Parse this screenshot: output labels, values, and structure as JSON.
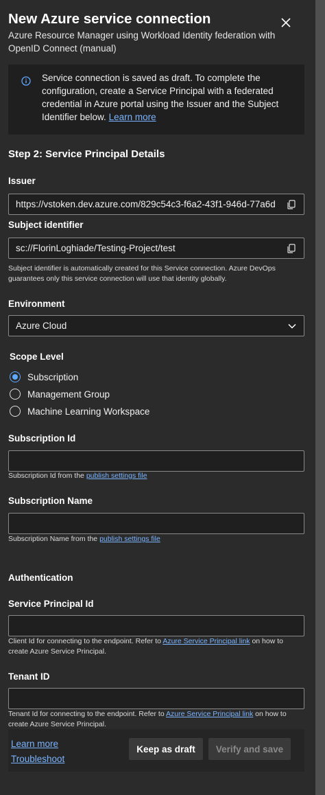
{
  "header": {
    "title": "New Azure service connection",
    "subtitle": "Azure Resource Manager using Workload Identity federation with OpenID Connect (manual)"
  },
  "info": {
    "text": "Service connection is saved as draft. To complete the configuration, create a Service Principal with a federated credential in Azure portal using the Issuer and the Subject Identifier below.",
    "link": "Learn more"
  },
  "step": {
    "title": "Step 2: Service Principal Details"
  },
  "issuer": {
    "label": "Issuer",
    "value": "https://vstoken.dev.azure.com/829c54c3-f6a2-43f1-946d-77a6d"
  },
  "subject": {
    "label": "Subject identifier",
    "value": "sc://FlorinLoghiade/Testing-Project/test",
    "help": "Subject identifier is automatically created for this Service connection. Azure DevOps guarantees only this service connection will use that identity globally."
  },
  "environment": {
    "label": "Environment",
    "value": "Azure Cloud"
  },
  "scope": {
    "label": "Scope Level",
    "options": [
      "Subscription",
      "Management Group",
      "Machine Learning Workspace"
    ],
    "selected": "Subscription"
  },
  "subscription_id": {
    "label": "Subscription Id",
    "value": "",
    "help_prefix": "Subscription Id from the ",
    "help_link": "publish settings file"
  },
  "subscription_name": {
    "label": "Subscription Name",
    "value": "",
    "help_prefix": "Subscription Name from the ",
    "help_link": "publish settings file"
  },
  "authentication": {
    "label": "Authentication"
  },
  "service_principal": {
    "label": "Service Principal Id",
    "value": "",
    "help_prefix": "Client Id for connecting to the endpoint. Refer to ",
    "help_link": "Azure Service Principal link",
    "help_suffix": " on how to create Azure Service Principal."
  },
  "tenant": {
    "label": "Tenant ID",
    "value": "",
    "help_prefix": "Tenant Id for connecting to the endpoint. Refer to ",
    "help_link": "Azure Service Principal link",
    "help_suffix": " on how to create Azure Service Principal."
  },
  "footer": {
    "learn_more": "Learn more",
    "troubleshoot": "Troubleshoot",
    "keep_draft": "Keep as draft",
    "verify_save": "Verify and save"
  },
  "colors": {
    "panel_bg": "#2b2b2b",
    "field_bg": "#1f1f1f",
    "accent": "#5fa8ff",
    "link": "#7ab4ff"
  },
  "icons": {
    "close": "close-icon",
    "info": "info-icon",
    "copy": "copy-icon",
    "dropdown": "chevron-down-icon"
  }
}
